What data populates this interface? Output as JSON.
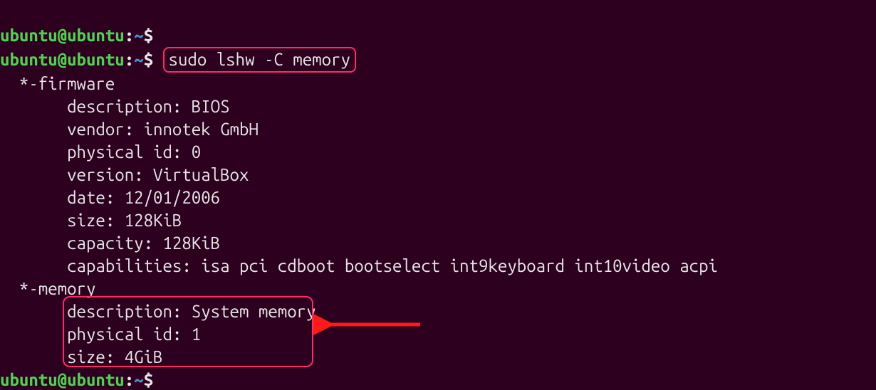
{
  "prompt": {
    "user": "ubuntu",
    "host": "ubuntu",
    "path": "~",
    "symbol": "$"
  },
  "command": "sudo lshw -C memory",
  "output": {
    "firmware_header": "  *-firmware",
    "firmware": {
      "description": "       description: BIOS",
      "vendor": "       vendor: innotek GmbH",
      "physical_id": "       physical id: 0",
      "version": "       version: VirtualBox",
      "date": "       date: 12/01/2006",
      "size": "       size: 128KiB",
      "capacity": "       capacity: 128KiB",
      "capabilities": "       capabilities: isa pci cdboot bootselect int9keyboard int10video acpi"
    },
    "memory_header": "  *-memory",
    "memory": {
      "description": "       description: System memory",
      "physical_id": "       physical id: 1",
      "size": "       size: 4GiB"
    }
  },
  "annotations": {
    "command_highlight": true,
    "memory_highlight": true,
    "arrow_points_to_memory_block": true
  }
}
